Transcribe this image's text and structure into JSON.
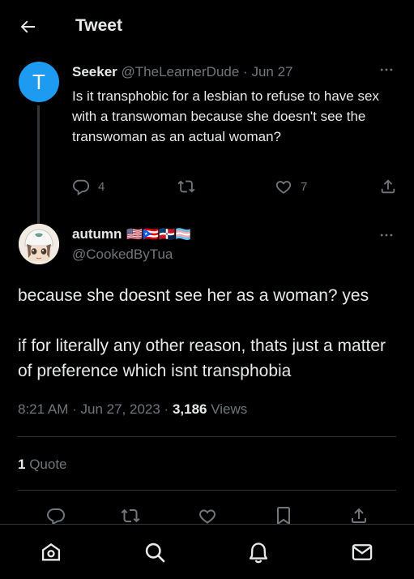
{
  "header": {
    "title": "Tweet"
  },
  "parent_tweet": {
    "avatar_letter": "T",
    "name": "Seeker",
    "handle": "@TheLearnerDude",
    "date": "Jun 27",
    "text": "Is it transphobic for a lesbian to refuse to have sex with a transwoman because she doesn't see the transwoman as an actual woman?",
    "reply_count": "4",
    "retweet_count": "",
    "like_count": "7"
  },
  "main_tweet": {
    "name": "autumn",
    "flags": "🇺🇸🇵🇷🇩🇴🏳️‍⚧️",
    "handle": "@CookedByTua",
    "text_line1": "because she doesnt see her as a woman? yes",
    "text_line2": "if for literally any other reason, thats just a matter of preference which isnt transphobia",
    "time": "8:21 AM",
    "date": "Jun 27, 2023",
    "views_count": "3,186",
    "views_label": "Views",
    "quote_count": "1",
    "quote_label": "Quote"
  },
  "icons": {
    "back": "arrow-left-icon",
    "more": "more-icon",
    "reply": "reply-icon",
    "retweet": "retweet-icon",
    "like": "heart-icon",
    "bookmark": "bookmark-icon",
    "share": "share-icon",
    "home": "home-icon",
    "search": "search-icon",
    "notifications": "bell-icon",
    "messages": "mail-icon"
  },
  "colors": {
    "background": "#000000",
    "text": "#e7e9ea",
    "muted": "#71767b",
    "accent": "#1d9bf0",
    "divider": "#2f3336"
  }
}
